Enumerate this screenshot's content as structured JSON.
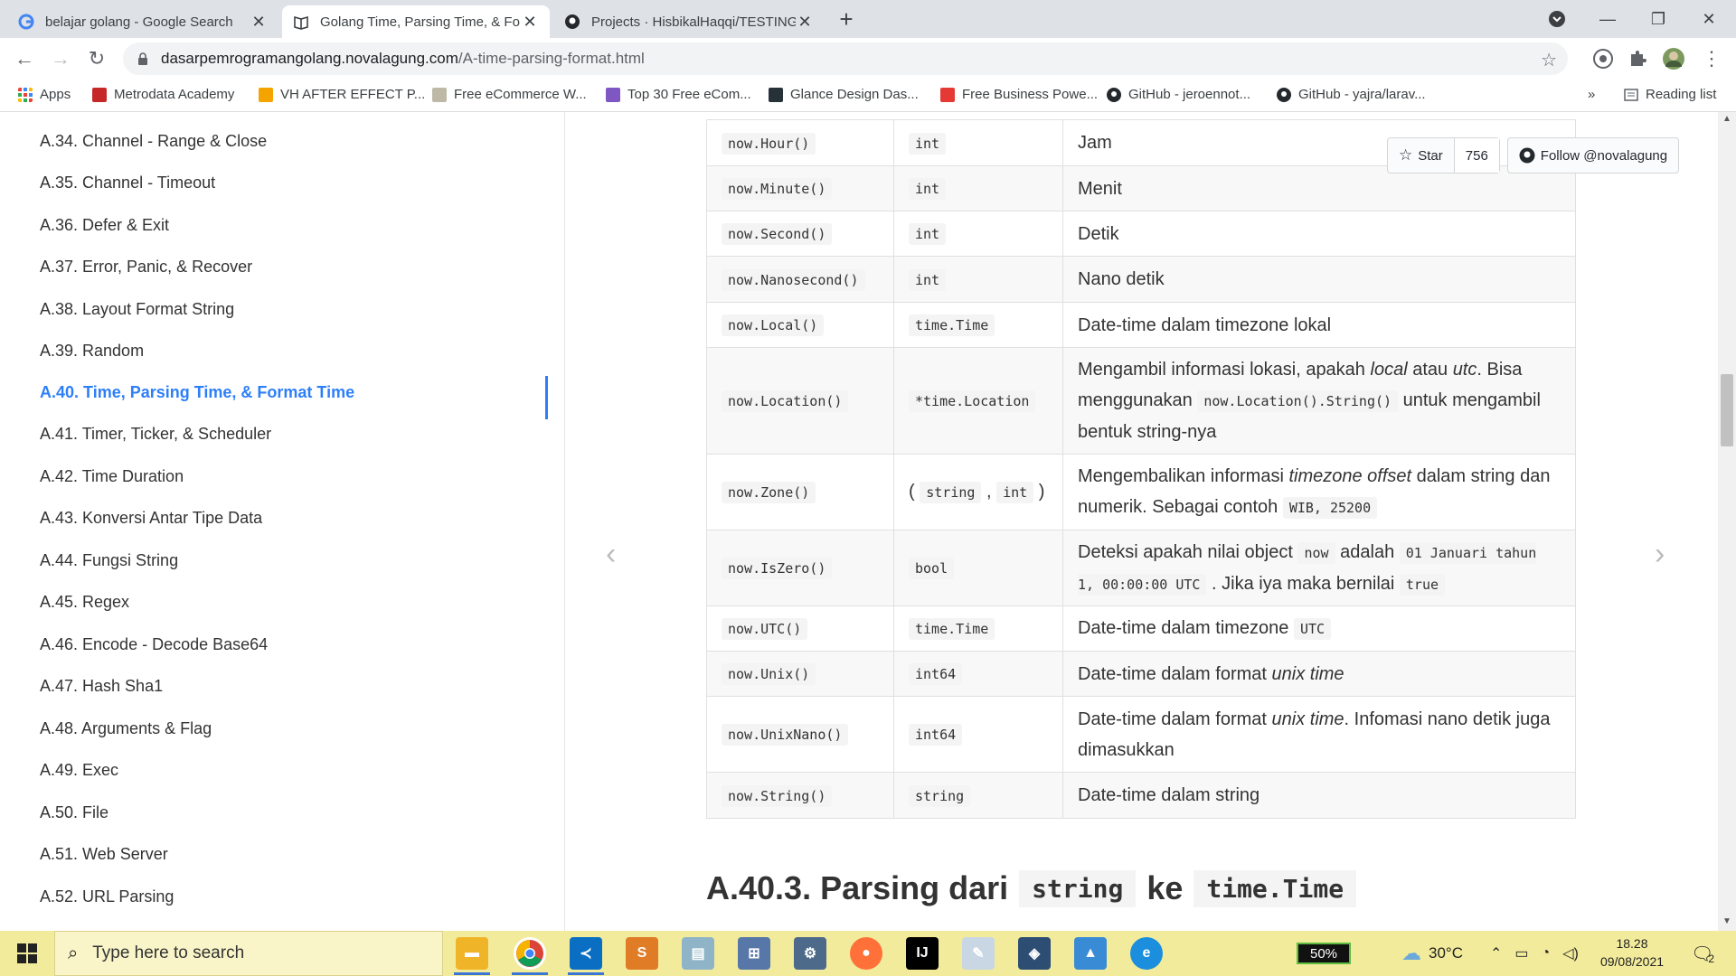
{
  "browser": {
    "tabs": [
      {
        "title": "belajar golang - Google Search",
        "icon": "google-icon"
      },
      {
        "title": "Golang Time, Parsing Time, & Fo",
        "icon": "book-icon"
      },
      {
        "title": "Projects · HisbikalHaqqi/TESTING",
        "icon": "github-icon"
      }
    ],
    "url_domain": "dasarpemrogramangolang.novalagung.com",
    "url_path": "/A-time-parsing-format.html",
    "bookmarks": [
      {
        "label": "Apps",
        "color": "#ea4335"
      },
      {
        "label": "Metrodata Academy",
        "color": "#c62828"
      },
      {
        "label": "VH AFTER EFFECT P...",
        "color": "#f4a300"
      },
      {
        "label": "Free eCommerce W...",
        "color": "#9e9e9e"
      },
      {
        "label": "Top 30 Free eCom...",
        "color": "#7e57c2"
      },
      {
        "label": "Glance Design Das...",
        "color": "#263238"
      },
      {
        "label": "Free Business Powe...",
        "color": "#e53935"
      },
      {
        "label": "GitHub - jeroennot...",
        "color": "#24292e"
      },
      {
        "label": "GitHub - yajra/larav...",
        "color": "#24292e"
      }
    ],
    "bookmarks_more": "»",
    "reading_list": "Reading list"
  },
  "sidebar": {
    "items": [
      "A.34. Channel - Range & Close",
      "A.35. Channel - Timeout",
      "A.36. Defer & Exit",
      "A.37. Error, Panic, & Recover",
      "A.38. Layout Format String",
      "A.39. Random",
      "A.40. Time, Parsing Time, & Format Time",
      "A.41. Timer, Ticker, & Scheduler",
      "A.42. Time Duration",
      "A.43. Konversi Antar Tipe Data",
      "A.44. Fungsi String",
      "A.45. Regex",
      "A.46. Encode - Decode Base64",
      "A.47. Hash Sha1",
      "A.48. Arguments & Flag",
      "A.49. Exec",
      "A.50. File",
      "A.51. Web Server",
      "A.52. URL Parsing"
    ],
    "active_index": 6
  },
  "github": {
    "star_label": "Star",
    "star_count": "756",
    "follow_label": "Follow @novalagung"
  },
  "table": {
    "rows": [
      {
        "method": "now.Hour()",
        "type": "int",
        "desc_text": "Jam"
      },
      {
        "method": "now.Minute()",
        "type": "int",
        "desc_text": "Menit"
      },
      {
        "method": "now.Second()",
        "type": "int",
        "desc_text": "Detik"
      },
      {
        "method": "now.Nanosecond()",
        "type": "int",
        "desc_text": "Nano detik"
      },
      {
        "method": "now.Local()",
        "type": "time.Time",
        "desc_text": "Date-time dalam timezone lokal"
      },
      {
        "method": "now.Location()",
        "type": "*time.Location",
        "desc_text": "Mengambil informasi lokasi, apakah local atau utc. Bisa menggunakan now.Location().String() untuk mengambil bentuk string-nya"
      },
      {
        "method": "now.Zone()",
        "type": "( string , int )",
        "desc_text": "Mengembalikan informasi timezone offset dalam string dan numerik. Sebagai contoh WIB, 25200"
      },
      {
        "method": "now.IsZero()",
        "type": "bool",
        "desc_text": "Deteksi apakah nilai object now adalah 01 Januari tahun 1, 00:00:00 UTC . Jika iya maka bernilai true"
      },
      {
        "method": "now.UTC()",
        "type": "time.Time",
        "desc_text": "Date-time dalam timezone UTC"
      },
      {
        "method": "now.Unix()",
        "type": "int64",
        "desc_text": "Date-time dalam format unix time"
      },
      {
        "method": "now.UnixNano()",
        "type": "int64",
        "desc_text": "Date-time dalam format unix time. Infomasi nano detik juga dimasukkan"
      },
      {
        "method": "now.String()",
        "type": "string",
        "desc_text": "Date-time dalam string"
      }
    ],
    "parts": {
      "loc_a": "Mengambil informasi lokasi, apakah ",
      "loc_local": "local",
      "loc_b": " atau ",
      "loc_utc": "utc",
      "loc_c": ". Bisa menggunakan ",
      "loc_code": "now.Location().String()",
      "loc_d": " untuk mengambil bentuk string-nya",
      "zone_a": "Mengembalikan informasi ",
      "zone_em": "timezone offset",
      "zone_b": " dalam string dan numerik. Sebagai contoh ",
      "zone_code": "WIB, 25200",
      "zone_t1": "string",
      "zone_t2": "int",
      "zone_p1": "(",
      "zone_comma": ",",
      "zone_p2": ")",
      "iz_a": "Deteksi apakah nilai object ",
      "iz_code1": "now",
      "iz_b": " adalah ",
      "iz_code2": "01 Januari tahun 1, 00:00:00 UTC",
      "iz_c": " . Jika iya maka bernilai ",
      "iz_code3": "true",
      "utc_a": "Date-time dalam timezone ",
      "utc_code": "UTC",
      "unix_a": "Date-time dalam format ",
      "unix_em": "unix time",
      "un_a": "Date-time dalam format ",
      "un_em": "unix time",
      "un_b": ". Infomasi nano detik juga dimasukkan"
    }
  },
  "heading": {
    "prefix": "A.40.3. Parsing dari",
    "code1": "string",
    "mid": "ke",
    "code2": "time.Time"
  },
  "taskbar": {
    "search_placeholder": "Type here to search",
    "battery": "50%",
    "temperature": "30°C",
    "time": "18.28",
    "date": "09/08/2021",
    "notifications": "2"
  }
}
